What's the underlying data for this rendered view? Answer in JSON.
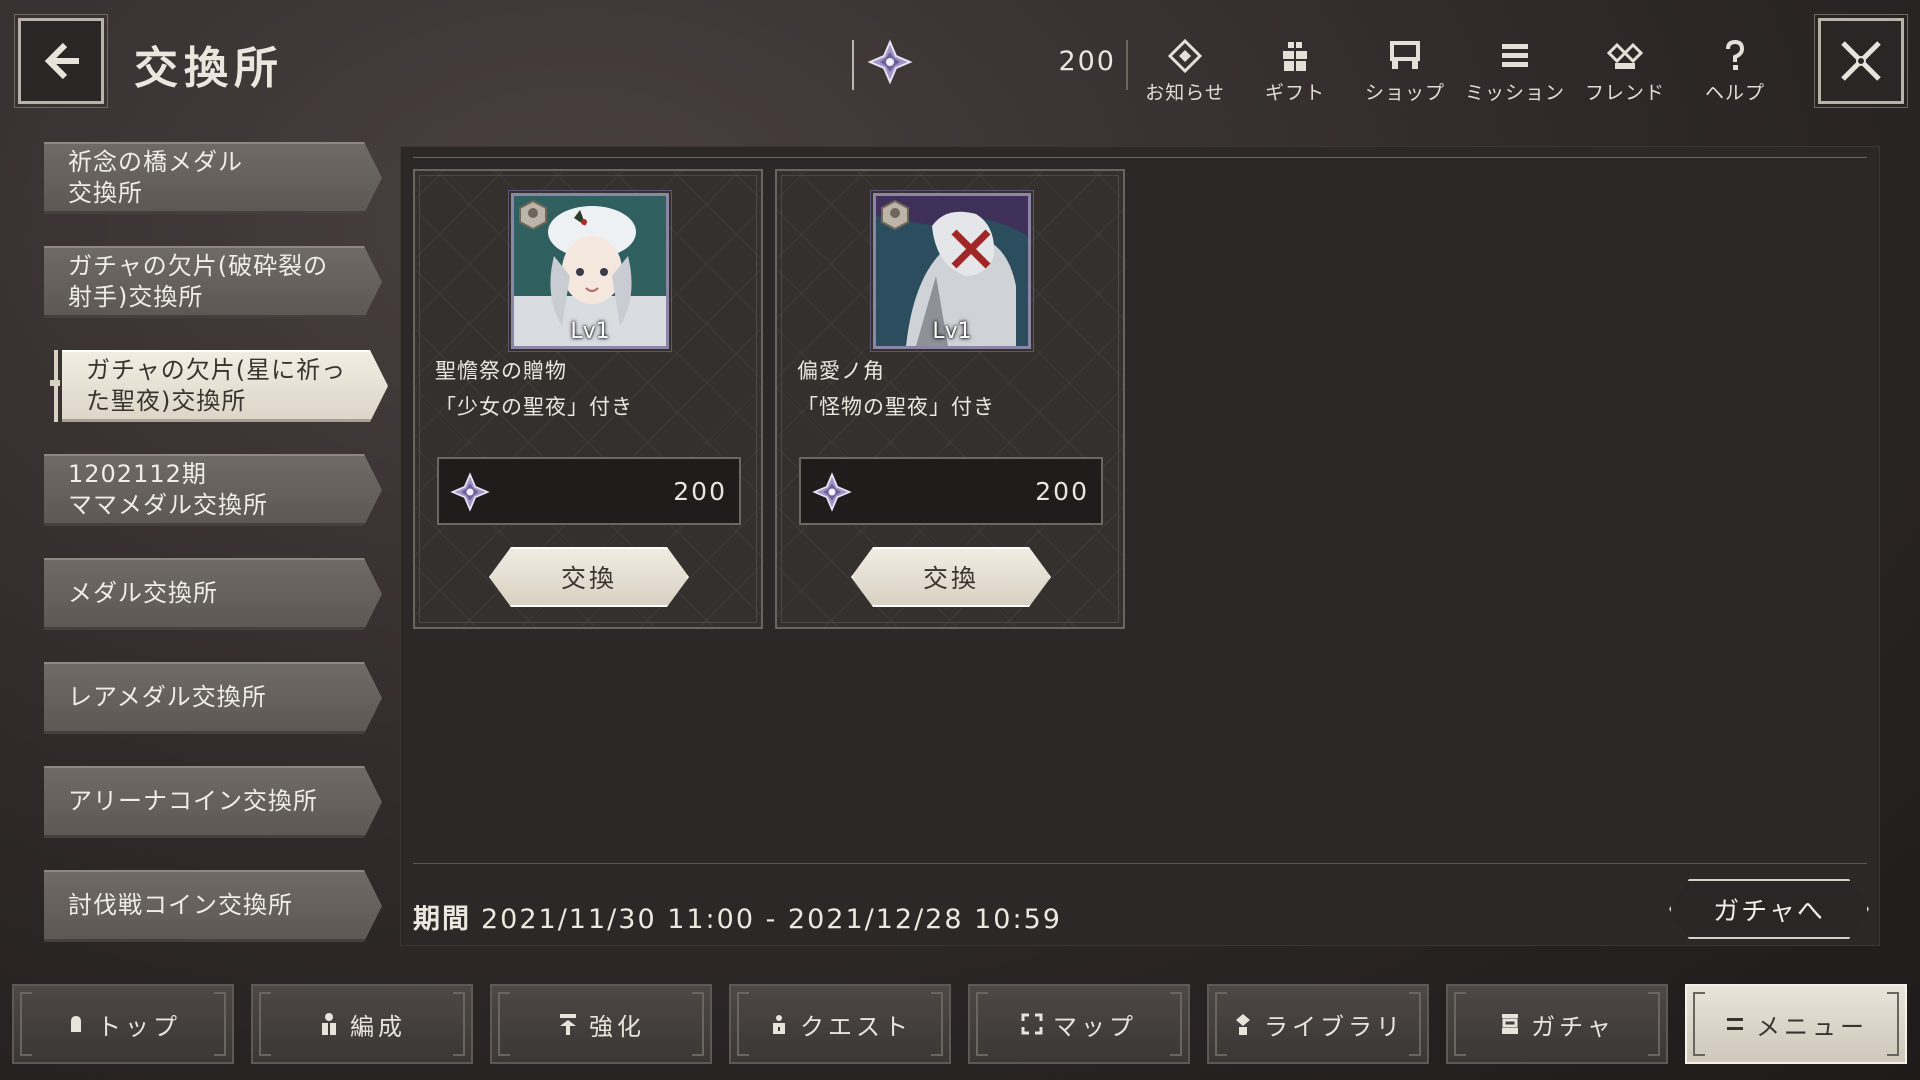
{
  "header": {
    "title": "交換所",
    "currency_value": "200",
    "icons": {
      "back": "arrow-left-icon",
      "close": "close-x-icon",
      "currency": "crystal-medal-icon"
    }
  },
  "top_nav": [
    {
      "label": "お知らせ",
      "icon": "diamond-notice-icon"
    },
    {
      "label": "ギフト",
      "icon": "gift-icon"
    },
    {
      "label": "ショップ",
      "icon": "shop-icon"
    },
    {
      "label": "ミッション",
      "icon": "list-icon"
    },
    {
      "label": "フレンド",
      "icon": "friend-icon"
    },
    {
      "label": "ヘルプ",
      "icon": "help-icon"
    }
  ],
  "sidebar": {
    "items": [
      {
        "line1": "祈念の橋メダル",
        "line2": "交換所"
      },
      {
        "line1": "ガチャの欠片(破砕裂の",
        "line2": "射手)交換所"
      },
      {
        "line1": "ガチャの欠片(星に祈っ",
        "line2": "た聖夜)交換所"
      },
      {
        "line1": "1202112期",
        "line2": "ママメダル交換所"
      },
      {
        "line1": "メダル交換所",
        "line2": ""
      },
      {
        "line1": "レアメダル交換所",
        "line2": ""
      },
      {
        "line1": "アリーナコイン交換所",
        "line2": ""
      },
      {
        "line1": "討伐戦コイン交換所",
        "line2": ""
      }
    ],
    "active_index": 2
  },
  "cards": [
    {
      "level": "Lv1",
      "name_line1": "聖憺祭の贈物",
      "name_line2": "「少女の聖夜」付き",
      "price": "200",
      "button": "交換",
      "accent": "#5c8a8a"
    },
    {
      "level": "Lv1",
      "name_line1": "偏愛ノ角",
      "name_line2": "「怪物の聖夜」付き",
      "price": "200",
      "button": "交換",
      "accent": "#3d5c6e"
    }
  ],
  "period": {
    "label": "期間",
    "value": "2021/11/30 11:00 - 2021/12/28 10:59"
  },
  "gacha_button": "ガチャへ",
  "bottom_nav": [
    {
      "label": "トップ",
      "icon": "home-icon"
    },
    {
      "label": "編成",
      "icon": "party-icon"
    },
    {
      "label": "強化",
      "icon": "upgrade-icon"
    },
    {
      "label": "クエスト",
      "icon": "quest-icon"
    },
    {
      "label": "マップ",
      "icon": "map-icon"
    },
    {
      "label": "ライブラリ",
      "icon": "library-icon"
    },
    {
      "label": "ガチャ",
      "icon": "gacha-icon"
    },
    {
      "label": "メニュー",
      "icon": "menu-icon"
    }
  ],
  "bottom_nav_active_index": 7
}
